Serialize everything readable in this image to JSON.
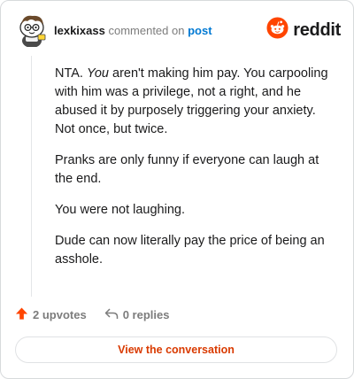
{
  "header": {
    "username": "lexkixass",
    "verb": "commented on",
    "post_link": "post",
    "avatar_icon": "snoo-avatar-icon",
    "brand_icon": "reddit-logo-icon",
    "brand_name": "reddit",
    "brand_color": "#ff4500"
  },
  "comment": {
    "p1_lead": "NTA. ",
    "p1_emph": "You",
    "p1_rest": " aren't making him pay. You carpooling with him was a privilege, not a right, and he abused it by purposely triggering your anxiety. Not once, but twice.",
    "p2": "Pranks are only funny if everyone can laugh at the end.",
    "p3": "You were not laughing.",
    "p4": "Dude can now literally pay the price of being an asshole."
  },
  "actions": {
    "upvote_icon": "upvote-arrow-icon",
    "upvotes_label": "2 upvotes",
    "reply_icon": "reply-arrow-icon",
    "replies_label": "0 replies"
  },
  "cta": {
    "label": "View the conversation",
    "color": "#d93a00"
  }
}
